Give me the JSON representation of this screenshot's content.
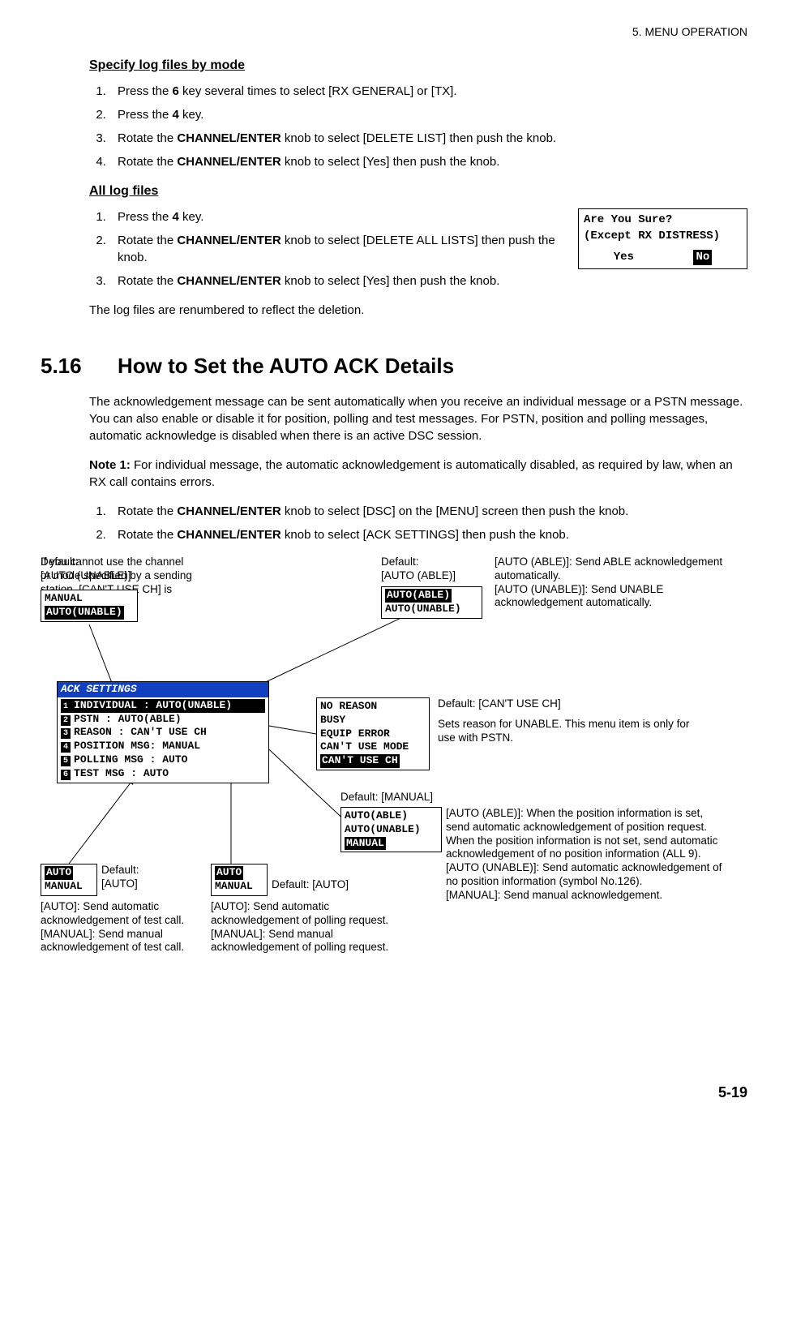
{
  "header": "5.  MENU OPERATION",
  "sub1": "Specify log files by mode",
  "steps1": {
    "s1a": "Press the ",
    "s1b": "6",
    "s1c": " key several times to select [RX GENERAL] or [TX].",
    "s2a": "Press the ",
    "s2b": "4",
    "s2c": " key.",
    "s3a": "Rotate the ",
    "s3b": "CHANNEL/ENTER",
    "s3c": " knob to select [DELETE LIST] then push the knob.",
    "s4a": "Rotate the ",
    "s4b": "CHANNEL/ENTER",
    "s4c": " knob to select [Yes] then push the knob."
  },
  "sub2": "All log files",
  "steps2": {
    "s1a": "Press the ",
    "s1b": "4",
    "s1c": " key.",
    "s2a": "Rotate the ",
    "s2b": "CHANNEL/ENTER",
    "s2c": " knob to select [DELETE ALL LISTS] then push the knob.",
    "s3a": "Rotate the ",
    "s3b": "CHANNEL/ENTER",
    "s3c": " knob to select [Yes] then push the knob."
  },
  "confirm": {
    "l1": "Are You Sure?",
    "l2": "(Except RX DISTRESS)",
    "yes": "Yes",
    "no": "No"
  },
  "after_delete": "The log files are renumbered to reflect the deletion.",
  "secnum": "5.16",
  "sectitle": "How to Set the AUTO ACK Details",
  "para1": "The acknowledgement message can be sent automatically when you receive an individual message or a PSTN message. You can also enable or disable it for position, polling and test messages. For PSTN, position and polling messages, automatic acknowledge is disabled when there is an active DSC session.",
  "note1_label": "Note 1:",
  "note1_body": " For individual message, the automatic acknowledgement is automatically disabled, as required by law, when an RX call contains errors.",
  "steps3": {
    "s1a": "Rotate the ",
    "s1b": "CHANNEL/ENTER",
    "s1c": " knob to select [DSC] on the [MENU] screen then push the knob.",
    "s2a": "Rotate the ",
    "s2b": "CHANNEL/ENTER",
    "s2c": " knob to select [ACK SETTINGS] then push the knob."
  },
  "diagram": {
    "def_unable": "Default:\n[AUTO (UNABLE)]",
    "cant_use_note": "If you cannot use the channel or mode specified by a sending station, [CAN'T USE CH] is automatically sent.",
    "def_able": "Default:\n[AUTO (ABLE)]",
    "able_unable_desc": "[AUTO (ABLE)]: Send ABLE acknowledgement automatically.\n[AUTO (UNABLE)]: Send UNABLE acknowledgement automatically.",
    "box_indiv": {
      "l1": "MANUAL",
      "l2": "AUTO(UNABLE)"
    },
    "box_pstn": {
      "l1": "AUTO(ABLE)",
      "l2": "AUTO(UNABLE)"
    },
    "ack_title": "ACK SETTINGS",
    "ack_rows": {
      "r1": "INDIVIDUAL  : AUTO(UNABLE)",
      "r2": "PSTN        : AUTO(ABLE)",
      "r3": "REASON      : CAN'T USE CH",
      "r4": "POSITION MSG: MANUAL",
      "r5": "POLLING MSG : AUTO",
      "r6": "TEST MSG    : AUTO"
    },
    "reason_box": {
      "l1": "NO REASON",
      "l2": "BUSY",
      "l3": "EQUIP ERROR",
      "l4": "CAN'T USE MODE",
      "l5": "CAN'T USE CH"
    },
    "reason_default": "Default: [CAN'T USE CH]",
    "reason_desc": "Sets reason for UNABLE. This menu item is only for use with PSTN.",
    "pos_default": "Default: [MANUAL]",
    "pos_box": {
      "l1": "AUTO(ABLE)",
      "l2": "AUTO(UNABLE)",
      "l3": "MANUAL"
    },
    "pos_desc": "[AUTO (ABLE)]: When the position information is set, send automatic acknowledgement of position request. When the position information is not set, send automatic acknowledgement of no position information (ALL 9).\n[AUTO (UNABLE)]: Send automatic acknowledgement of no position information (symbol No.126).\n[MANUAL]: Send manual acknowledgement.",
    "test_box": {
      "l1": "AUTO",
      "l2": "MANUAL"
    },
    "test_default": "Default:\n[AUTO]",
    "test_desc": "[AUTO]: Send automatic acknowledgement of test call.\n[MANUAL]: Send manual acknowledgement of test call.",
    "poll_box": {
      "l1": "AUTO",
      "l2": "MANUAL"
    },
    "poll_default": "Default: [AUTO]",
    "poll_desc": "[AUTO]: Send automatic acknowledgement of polling request.\n[MANUAL]: Send manual acknowledgement of polling request."
  },
  "page": "5-19"
}
